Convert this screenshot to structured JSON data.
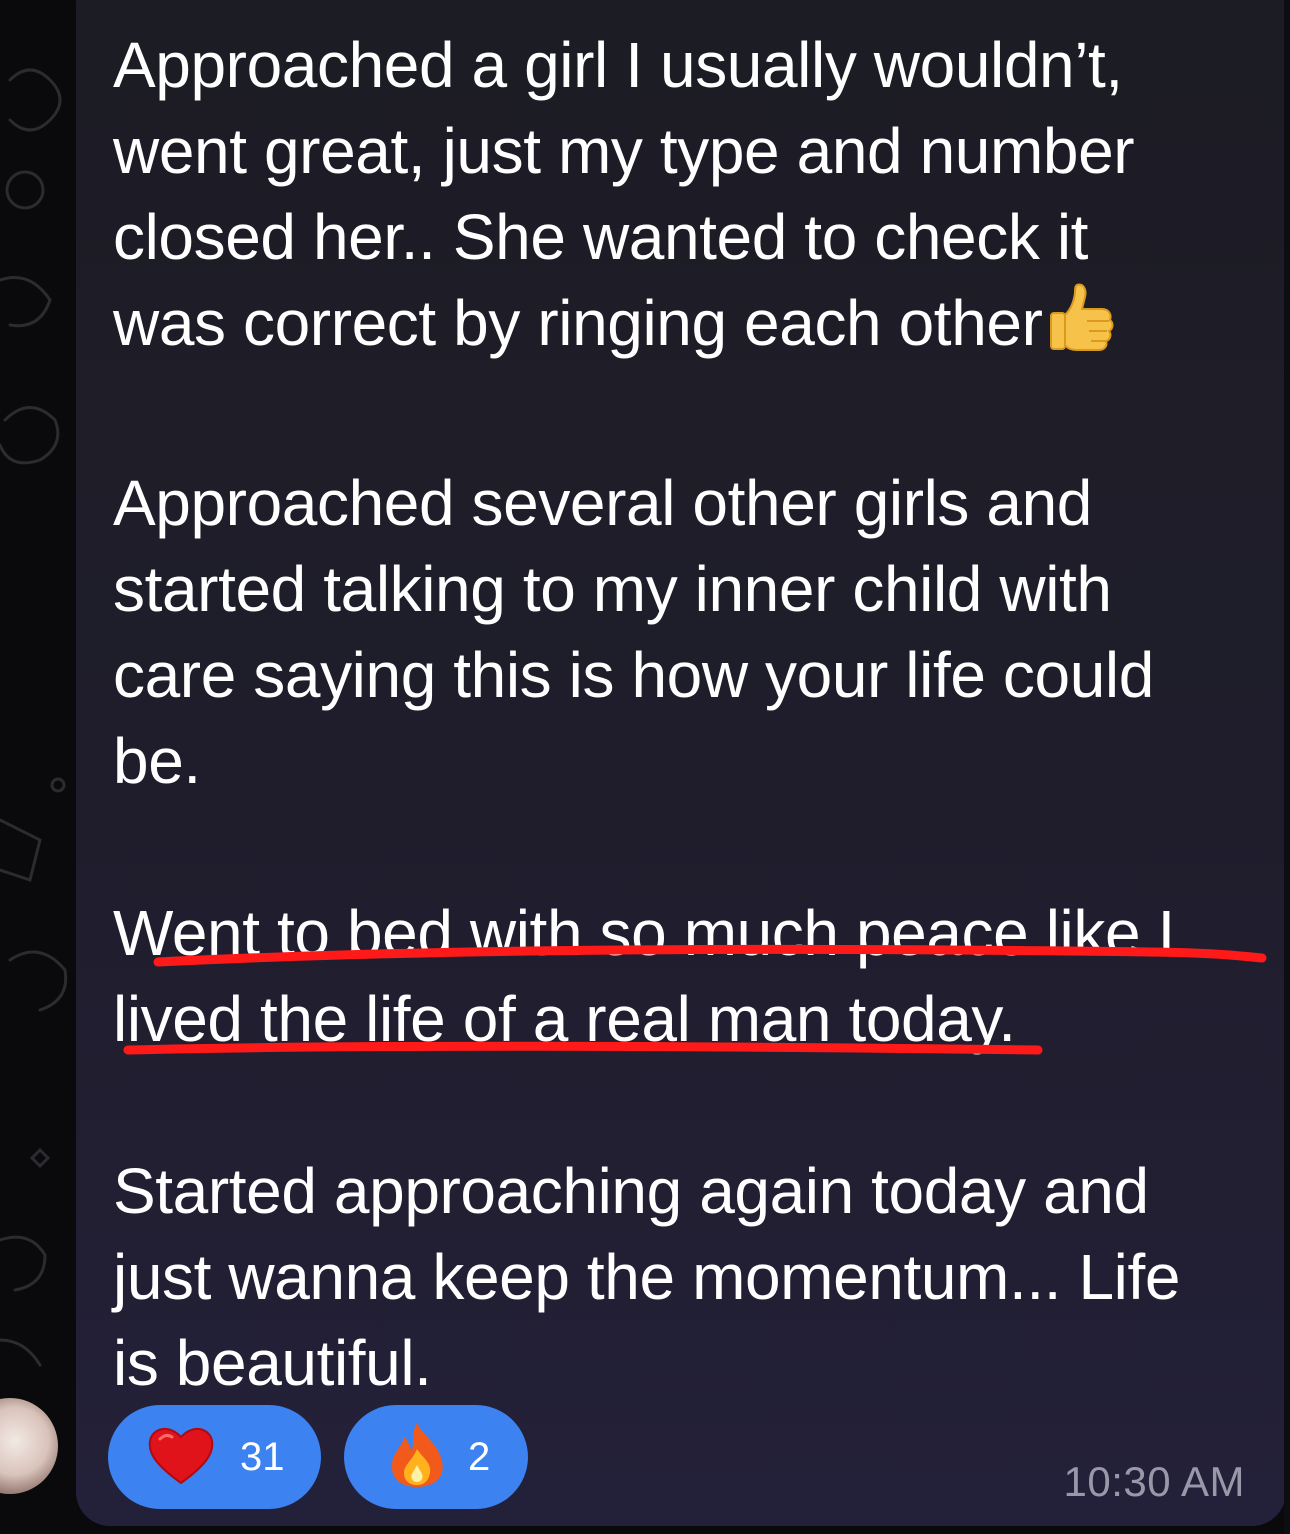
{
  "message": {
    "paragraph_1": "Approached a girl I usually wouldn’t,\nwent great, just my type and number\nclosed her.. She wanted to check it\nwas correct by ringing each other",
    "paragraph_2": "Approached several other girls and\nstarted talking to my inner child with\ncare saying this is how your life could\nbe.",
    "paragraph_3": "Went to bed with so much peace like I\nlived the life of a real man today.",
    "paragraph_4": "Started approaching again today and\njust wanna keep the momentum... Life\nis beautiful.",
    "emoji": "thumbs-up-icon",
    "timestamp": "10:30 AM"
  },
  "reactions": [
    {
      "icon": "heart-icon",
      "count": "31"
    },
    {
      "icon": "fire-icon",
      "count": "2"
    }
  ],
  "colors": {
    "reaction_bg": "#3d82f1",
    "underline": "#ff1a1a",
    "bubble": "#1f1d2c",
    "text": "#ffffff",
    "timestamp": "#9a98a8"
  }
}
